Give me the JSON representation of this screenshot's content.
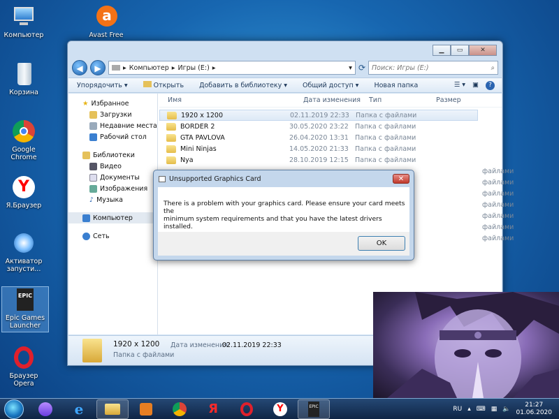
{
  "desktop": {
    "icons": [
      {
        "label": "Компьютер"
      },
      {
        "label": "Avast Free"
      },
      {
        "label": "Корзина"
      },
      {
        "label": "Google Chrome"
      },
      {
        "label": "Я.Браузер"
      },
      {
        "label": "Активатор запусти..."
      },
      {
        "label": "Epic Games Launcher"
      },
      {
        "label": "Браузер Opera"
      }
    ]
  },
  "explorer": {
    "address": [
      "Компьютер",
      "Игры (E:)"
    ],
    "search_placeholder": "Поиск: Игры (E:)",
    "toolbar": {
      "organize": "Упорядочить",
      "open": "Открыть",
      "add_library": "Добавить в библиотеку",
      "share": "Общий доступ",
      "new_folder": "Новая папка"
    },
    "nav": {
      "favorites": "Избранное",
      "downloads": "Загрузки",
      "recent": "Недавние места",
      "desktop": "Рабочий стол",
      "libraries": "Библиотеки",
      "video": "Видео",
      "documents": "Документы",
      "images": "Изображения",
      "music": "Музыка",
      "computer": "Компьютер",
      "network": "Сеть"
    },
    "columns": {
      "name": "Имя",
      "date": "Дата изменения",
      "type": "Тип",
      "size": "Размер"
    },
    "files": [
      {
        "name": "1920 x 1200",
        "date": "02.11.2019 22:33",
        "type": "Папка с файлами"
      },
      {
        "name": "BORDER 2",
        "date": "30.05.2020 23:22",
        "type": "Папка с файлами"
      },
      {
        "name": "GTA PAVLOVA",
        "date": "26.04.2020 13:31",
        "type": "Папка с файлами"
      },
      {
        "name": "Mini Ninjas",
        "date": "14.05.2020 21:33",
        "type": "Папка с файлами"
      },
      {
        "name": "Nya",
        "date": "28.10.2019 12:15",
        "type": "Папка с файлами"
      }
    ],
    "extra_type_rows": [
      "файлами",
      "файлами",
      "файлами",
      "файлами",
      "файлами",
      "файлами",
      "файлами"
    ],
    "details": {
      "name": "1920 x 1200",
      "date_label": "Дата изменения:",
      "date_value": "02.11.2019 22:33",
      "type": "Папка с файлами"
    }
  },
  "dialog": {
    "title": "Unsupported Graphics Card",
    "message_line1": "There is a problem with your graphics card. Please ensure your card meets the",
    "message_line2": "minimum system requirements and that you have the latest drivers installed.",
    "ok": "OK"
  },
  "tray": {
    "lang": "RU",
    "time": "21:27",
    "date": "01.06.2020"
  }
}
